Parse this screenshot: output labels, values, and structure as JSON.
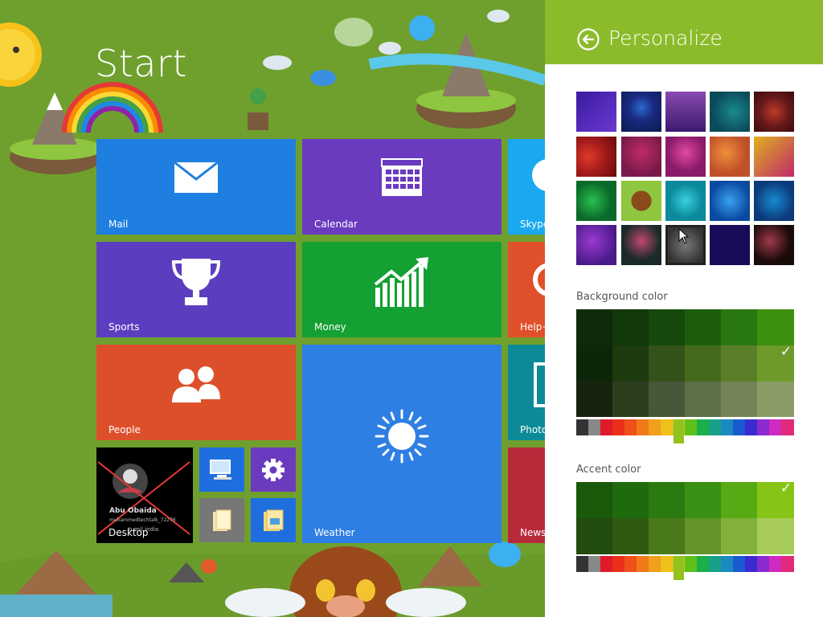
{
  "start": {
    "title": "Start",
    "tiles": [
      {
        "label": "Mail",
        "color": "#1f7fe0",
        "icon": "mail-icon"
      },
      {
        "label": "Calendar",
        "color": "#6b3bbf",
        "icon": "calendar-icon"
      },
      {
        "label": "Skype",
        "color": "#1aa9f0",
        "icon": "skype-icon"
      },
      {
        "label": "Sports",
        "color": "#5b3ec0",
        "icon": "trophy-icon"
      },
      {
        "label": "Money",
        "color": "#14a032",
        "icon": "chart-icon"
      },
      {
        "label": "Help+",
        "color": "#e0502a",
        "icon": "help-icon"
      },
      {
        "label": "People",
        "color": "#dd4f2a",
        "icon": "people-icon"
      },
      {
        "label": "Weather",
        "color": "#2e7fe4",
        "icon": "sun-icon"
      },
      {
        "label": "Photos",
        "color": "#0d8a98",
        "icon": "photo-icon"
      },
      {
        "label": "Desktop",
        "color": "#000000",
        "icon": "desktop-icon"
      },
      {
        "label": "News",
        "color": "#b82a3a",
        "icon": "news-icon"
      }
    ],
    "desktop_user": {
      "name": "Abu Obaida",
      "subtitle": "muhammedtechtalk_72276",
      "location": "tumil india"
    }
  },
  "panel": {
    "title": "Personalize",
    "background_color_label": "Background color",
    "accent_color_label": "Accent color",
    "header_color": "#8bbb2a",
    "selected_background_swatch": "row1-col6",
    "selected_accent_swatch": "row1-col6"
  }
}
